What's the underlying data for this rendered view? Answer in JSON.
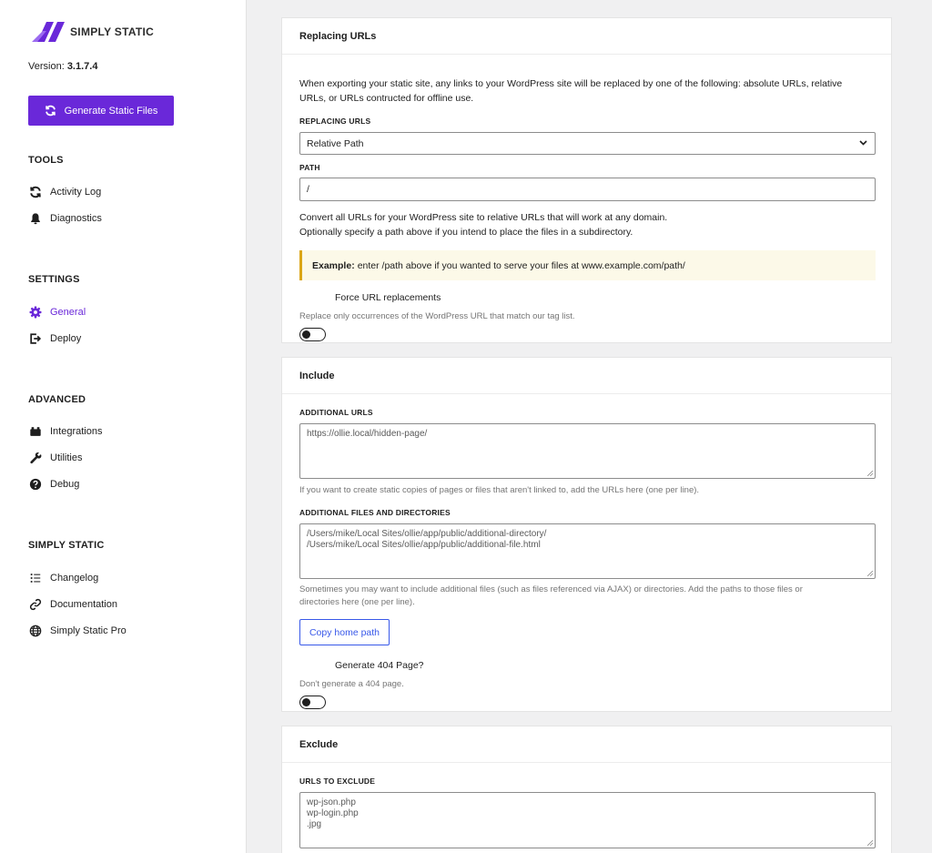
{
  "brand": {
    "name": "SIMPLY STATIC",
    "accent": "#6a28d9"
  },
  "version": {
    "label": "Version:",
    "value": "3.1.7.4"
  },
  "generate_button": {
    "label": "Generate Static Files",
    "icon": "refresh-icon"
  },
  "sidebar": {
    "tools": {
      "title": "TOOLS",
      "items": [
        {
          "label": "Activity Log",
          "icon": "refresh-icon"
        },
        {
          "label": "Diagnostics",
          "icon": "bell-icon"
        }
      ]
    },
    "settings": {
      "title": "SETTINGS",
      "items": [
        {
          "label": "General",
          "icon": "gear-icon",
          "active": true
        },
        {
          "label": "Deploy",
          "icon": "export-icon"
        }
      ]
    },
    "advanced": {
      "title": "ADVANCED",
      "items": [
        {
          "label": "Integrations",
          "icon": "plugin-icon"
        },
        {
          "label": "Utilities",
          "icon": "wrench-icon"
        },
        {
          "label": "Debug",
          "icon": "help-icon"
        }
      ]
    },
    "simply_static": {
      "title": "SIMPLY STATIC",
      "items": [
        {
          "label": "Changelog",
          "icon": "list-icon"
        },
        {
          "label": "Documentation",
          "icon": "link-icon"
        },
        {
          "label": "Simply Static Pro",
          "icon": "globe-icon"
        }
      ]
    }
  },
  "replacing": {
    "title": "Replacing URLs",
    "intro_line1": "When exporting your static site, any links to your WordPress site will be replaced by one of the following: absolute URLs, relative",
    "intro_line2": "URLs, or URLs contructed for offline use.",
    "select_label": "REPLACING URLS",
    "select_value": "Relative Path",
    "path_label": "PATH",
    "path_value": "/",
    "desc_line1": "Convert all URLs for your WordPress site to relative URLs that will work at any domain.",
    "desc_line2": "Optionally specify a path above if you intend to place the files in a subdirectory.",
    "example_strong": "Example:",
    "example_text": "enter /path above if you wanted to serve your files at www.example.com/path/",
    "toggle_label": "Force URL replacements",
    "toggle_hint": "Replace only occurrences of the WordPress URL that match our tag list."
  },
  "include": {
    "title": "Include",
    "urls_label": "ADDITIONAL URLS",
    "urls_placeholder": "https://ollie.local/hidden-page/",
    "urls_hint": "If you want to create static copies of pages or files that aren't linked to, add the URLs here (one per line).",
    "files_label": "ADDITIONAL FILES AND DIRECTORIES",
    "files_lines": [
      "/Users/mike/Local Sites/ollie/app/public/additional-directory/",
      "/Users/mike/Local Sites/ollie/app/public/additional-file.html"
    ],
    "files_hint_line1": "Sometimes you may want to include additional files (such as files referenced via AJAX) or directories. Add the paths to those files or",
    "files_hint_line2": "directories here (one per line).",
    "copy_button": "Copy home path",
    "toggle_label": "Generate 404 Page?",
    "toggle_hint": "Don't generate a 404 page."
  },
  "exclude": {
    "title": "Exclude",
    "urls_label": "URLS TO EXCLUDE",
    "urls_lines": [
      "wp-json.php",
      "wp-login.php",
      ".jpg"
    ]
  }
}
